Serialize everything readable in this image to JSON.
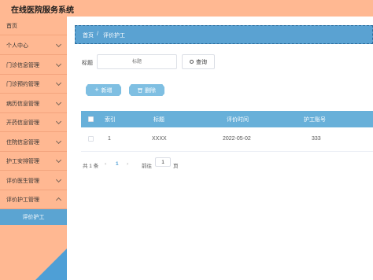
{
  "app": {
    "title": "在线医院服务系统"
  },
  "sidebar": {
    "items": [
      {
        "label": "首页",
        "has_sub": false
      },
      {
        "label": "个人中心",
        "has_sub": true
      },
      {
        "label": "门诊信息管理",
        "has_sub": true
      },
      {
        "label": "门诊预约管理",
        "has_sub": true
      },
      {
        "label": "病历信息管理",
        "has_sub": true
      },
      {
        "label": "开药信息管理",
        "has_sub": true
      },
      {
        "label": "住院信息管理",
        "has_sub": true
      },
      {
        "label": "护工安排管理",
        "has_sub": true
      },
      {
        "label": "评价医生管理",
        "has_sub": true
      },
      {
        "label": "评价护工管理",
        "has_sub": true
      }
    ],
    "active_sub_item": "评价护工"
  },
  "breadcrumb": {
    "home": "首页",
    "separator": "/",
    "current": "评价护工"
  },
  "search": {
    "label": "标题",
    "placeholder": "标题",
    "button_label": "查询"
  },
  "toolbar": {
    "add_label": "新增",
    "delete_label": "删除"
  },
  "table": {
    "columns": [
      "索引",
      "标题",
      "评价时间",
      "护工账号"
    ],
    "rows": [
      {
        "index": "1",
        "title": "XXXX",
        "time": "2022-05-02",
        "account": "333"
      }
    ]
  },
  "pagination": {
    "total_text": "共 1 条",
    "current_page": "1",
    "goto_label": "前往",
    "goto_value": "1",
    "page_suffix": "页"
  },
  "colors": {
    "header": "#ffb892",
    "accent": "#5aa2d2",
    "table_head": "#68b0d9"
  }
}
